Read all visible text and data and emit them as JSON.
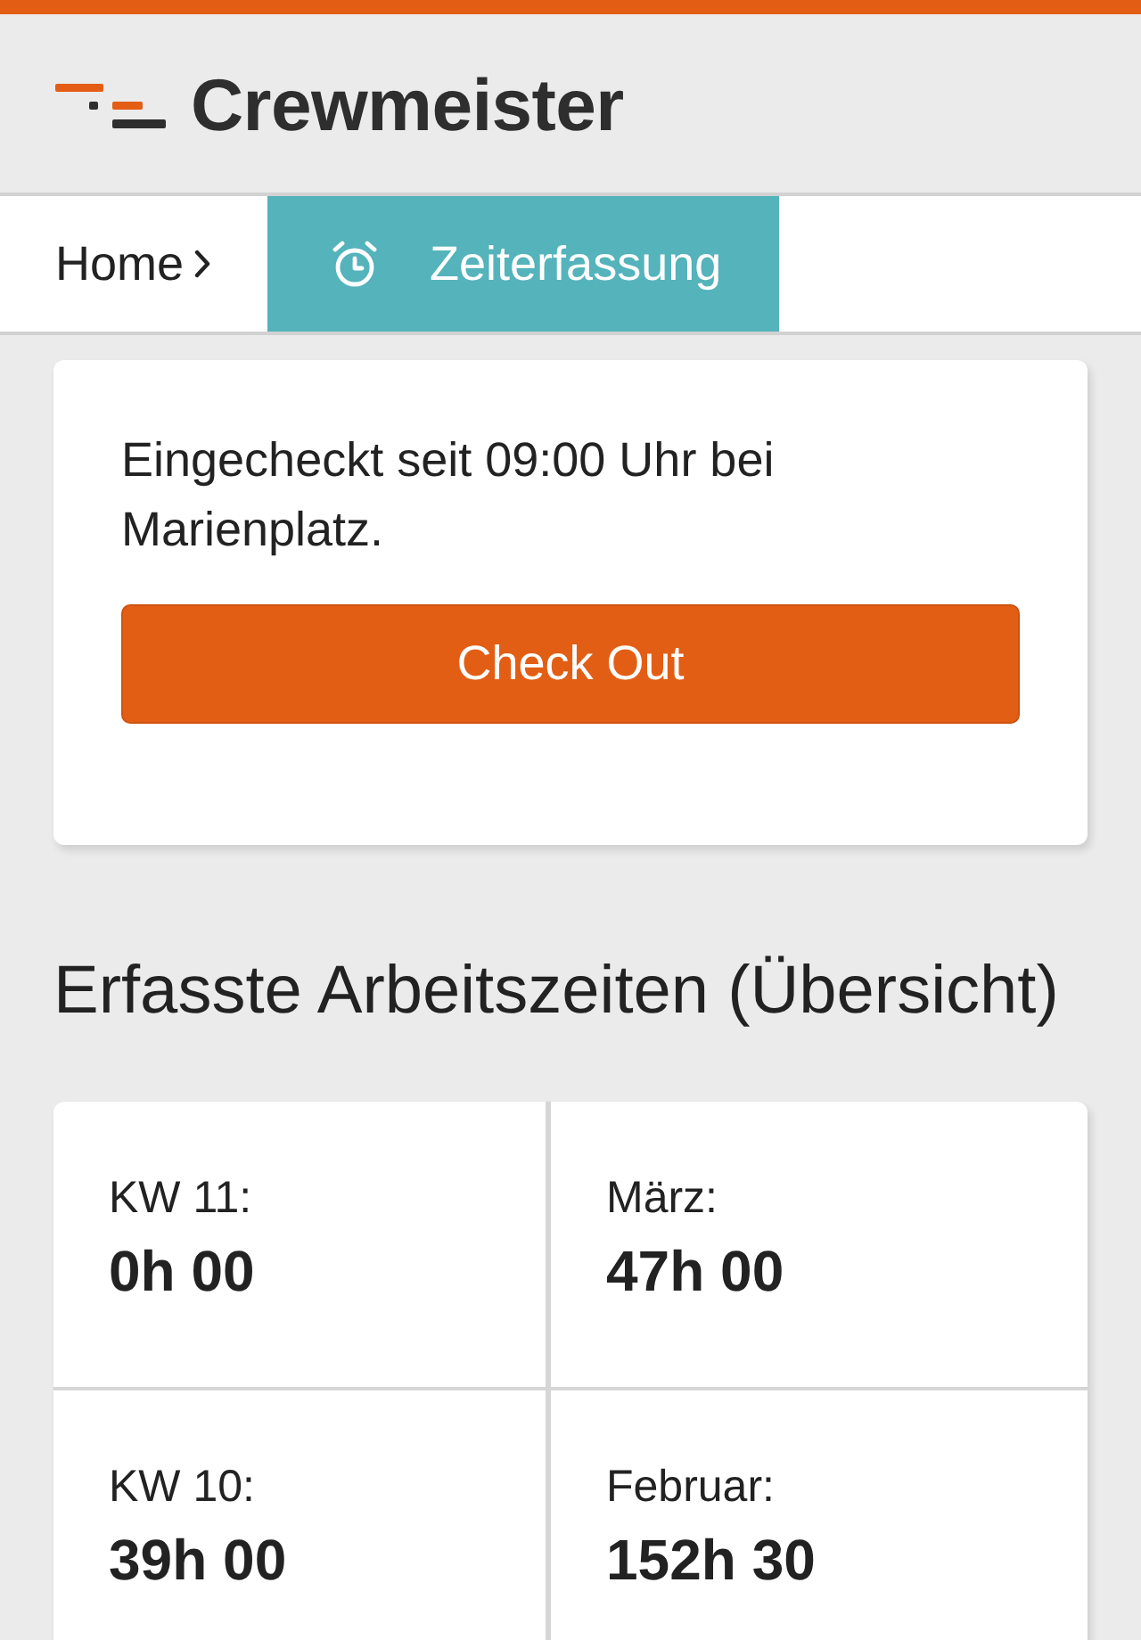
{
  "header": {
    "logo_text": "Crewmeister"
  },
  "breadcrumb": [
    {
      "label": "Home",
      "kind": "home",
      "selected": false
    },
    {
      "label": "Zeiterfassung",
      "kind": "section",
      "selected": true
    }
  ],
  "checkin_card": {
    "message": "Eingecheckt seit 09:00 Uhr bei Marienplatz.",
    "button": "Check Out"
  },
  "summary": {
    "title": "Erfasste Arbeitszeiten (Übersicht)",
    "cells": [
      {
        "label": "KW 11:",
        "value": "0h 00"
      },
      {
        "label": "März:",
        "value": "47h 00"
      },
      {
        "label": "KW 10:",
        "value": "39h 00"
      },
      {
        "label": "Februar:",
        "value": "152h 30"
      }
    ]
  }
}
